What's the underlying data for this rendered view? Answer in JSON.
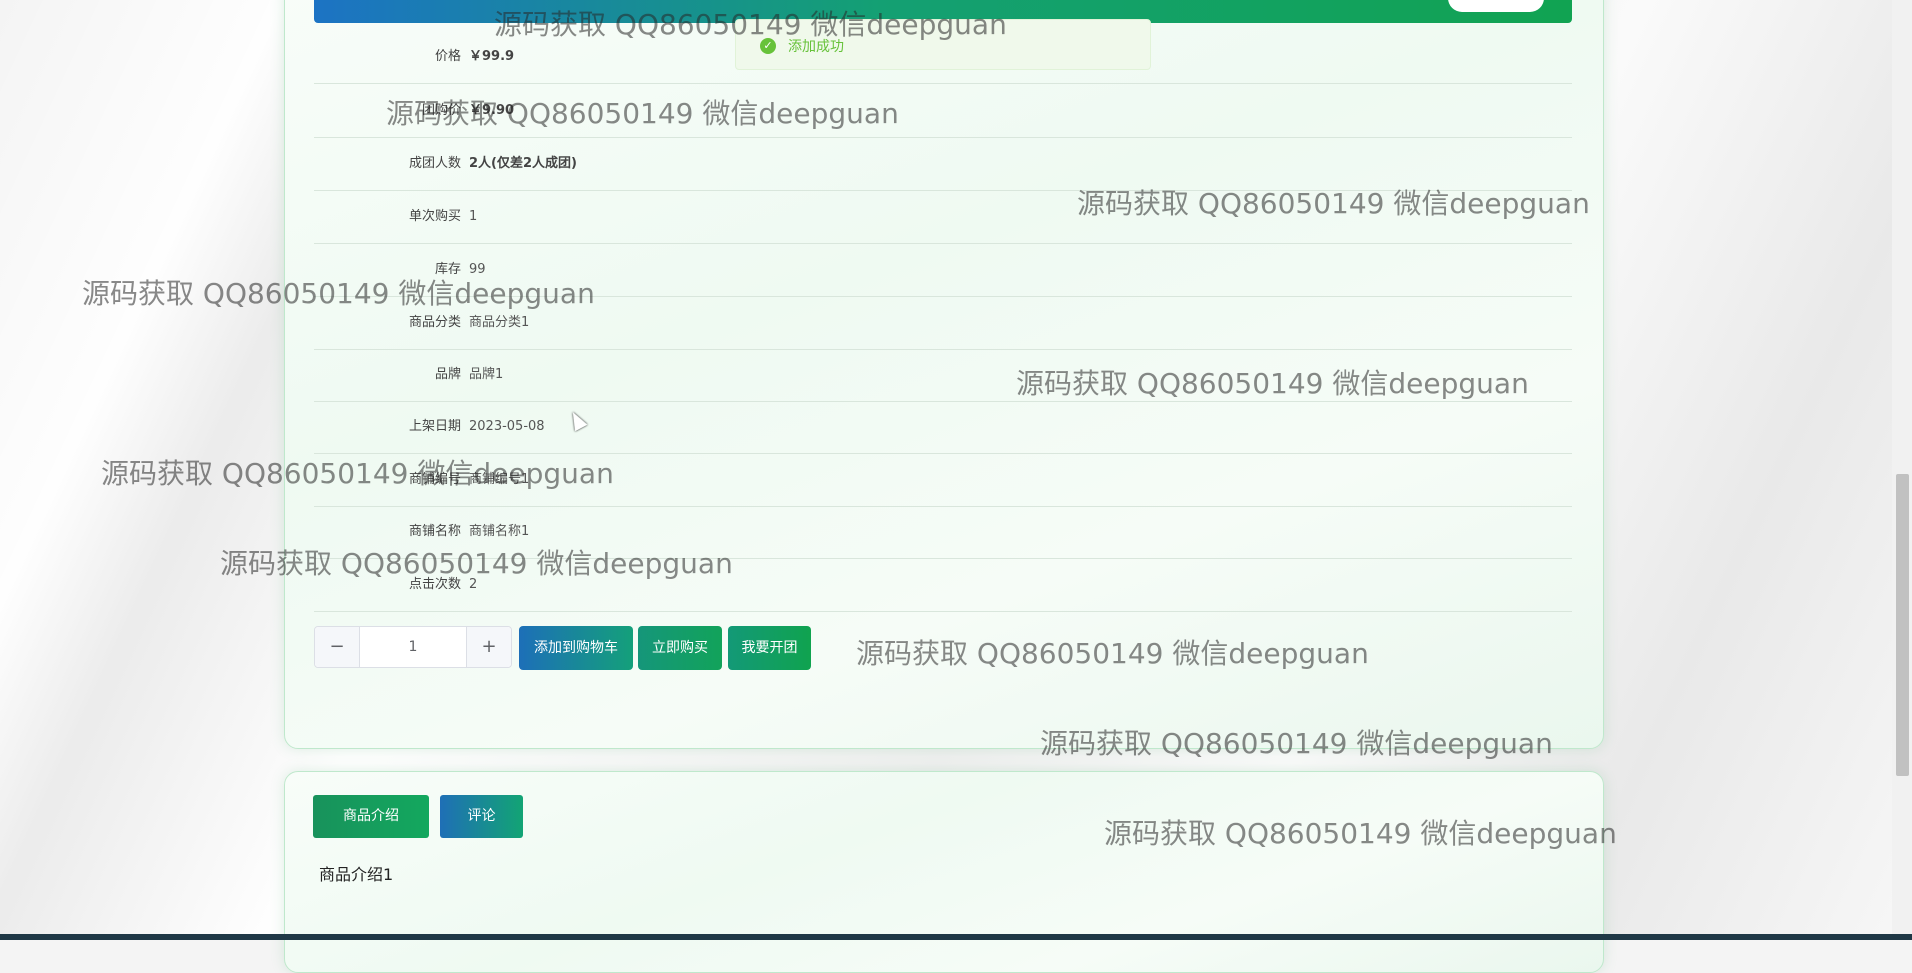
{
  "toast": {
    "message": "添加成功",
    "icon": "check-circle-icon"
  },
  "details": [
    {
      "label": "价格",
      "value": "￥99.9",
      "bold": true
    },
    {
      "label": "团购价",
      "value": "￥9.90",
      "bold": true
    },
    {
      "label": "成团人数",
      "value": "2人(仅差2人成团)",
      "bold": true
    },
    {
      "label": "单次购买",
      "value": "1",
      "bold": false
    },
    {
      "label": "库存",
      "value": "99",
      "bold": false
    },
    {
      "label": "商品分类",
      "value": "商品分类1",
      "bold": false
    },
    {
      "label": "品牌",
      "value": "品牌1",
      "bold": false
    },
    {
      "label": "上架日期",
      "value": "2023-05-08",
      "bold": false
    },
    {
      "label": "商铺编号",
      "value": "商铺编号1",
      "bold": false
    },
    {
      "label": "商铺名称",
      "value": "商铺名称1",
      "bold": false
    },
    {
      "label": "点击次数",
      "value": "2",
      "bold": false
    }
  ],
  "quantity": {
    "value": "1",
    "minus": "−",
    "plus": "+"
  },
  "actions": {
    "add_to_cart": "添加到购物车",
    "buy_now": "立即购买",
    "start_group": "我要开团"
  },
  "tabs": {
    "intro": "商品介绍",
    "comments": "评论"
  },
  "intro_content": "商品介绍1",
  "watermark": "源码获取 QQ86050149 微信deepguan",
  "colors": {
    "brand_green": "#13a85e",
    "brand_blue": "#1d6fb8",
    "toast_green": "#67c23a"
  }
}
